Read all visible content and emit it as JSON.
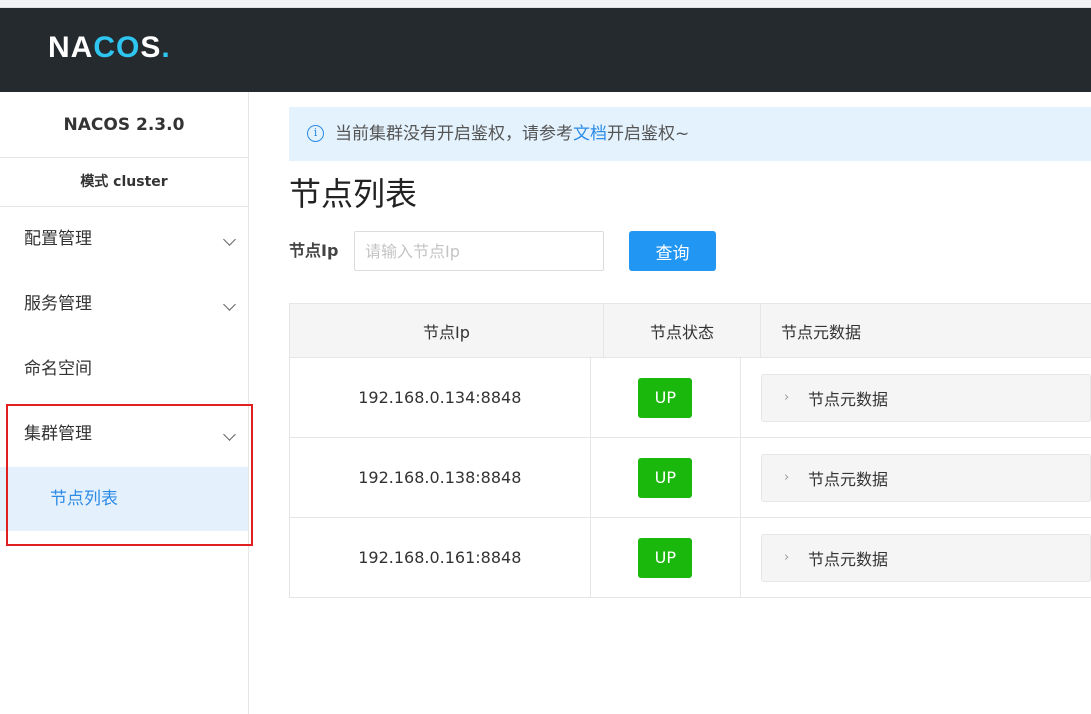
{
  "header": {
    "logo_text_a": "NA",
    "logo_text_ring": "CO",
    "logo_text_b": "S",
    "logo_dot": "."
  },
  "sidebar": {
    "version": "NACOS 2.3.0",
    "mode": "模式 cluster",
    "items": [
      {
        "label": "配置管理"
      },
      {
        "label": "服务管理"
      },
      {
        "label": "命名空间"
      },
      {
        "label": "集群管理"
      }
    ],
    "sub_item": {
      "label": "节点列表"
    }
  },
  "notice": {
    "text_before": "当前集群没有开启鉴权，请参考",
    "link": "文档",
    "text_after": "开启鉴权~",
    "icon": "info-icon"
  },
  "page": {
    "title": "节点列表"
  },
  "search": {
    "label": "节点Ip",
    "placeholder": "请输入节点Ip",
    "value": "",
    "button": "查询"
  },
  "table": {
    "headers": [
      "节点Ip",
      "节点状态",
      "节点元数据"
    ],
    "rows": [
      {
        "ip": "192.168.0.134:8848",
        "state": "UP",
        "meta": "节点元数据"
      },
      {
        "ip": "192.168.0.138:8848",
        "state": "UP",
        "meta": "节点元数据"
      },
      {
        "ip": "192.168.0.161:8848",
        "state": "UP",
        "meta": "节点元数据"
      }
    ]
  },
  "colors": {
    "header_bg": "#252a2f",
    "accent": "#2196f3",
    "up_badge": "#1ab80c",
    "highlight_border": "#e02020",
    "notice_bg": "#e3f2fd"
  }
}
